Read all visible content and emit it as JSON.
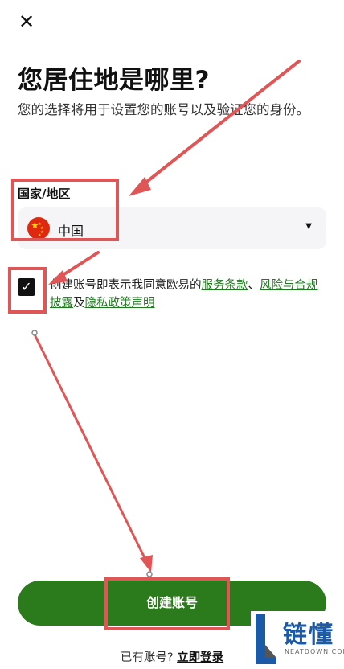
{
  "header": {
    "close_icon": "close-icon"
  },
  "page": {
    "title": "您居住地是哪里?",
    "subtitle": "您的选择将用于设置您的账号以及验证您的身份。"
  },
  "country": {
    "label": "国家/地区",
    "value": "中国",
    "flag_icon": "china-flag-icon",
    "caret_icon": "chevron-down-icon"
  },
  "consent": {
    "checked": true,
    "prefix": "创建账号即表示我同意欧易的",
    "link1": "服务条款",
    "sep1": "、",
    "link2": "风险与合规披露",
    "sep2": "及",
    "link3": "隐私政策声明"
  },
  "actions": {
    "create_label": "创建账号",
    "login_prompt": "已有账号?",
    "login_link": "立即登录"
  },
  "watermark": {
    "brand": "链懂",
    "domain": "NEATDOWN.COM"
  },
  "colors": {
    "accent": "#2b7a1c",
    "link": "#1d7a1d",
    "annotation": "#e05555"
  }
}
